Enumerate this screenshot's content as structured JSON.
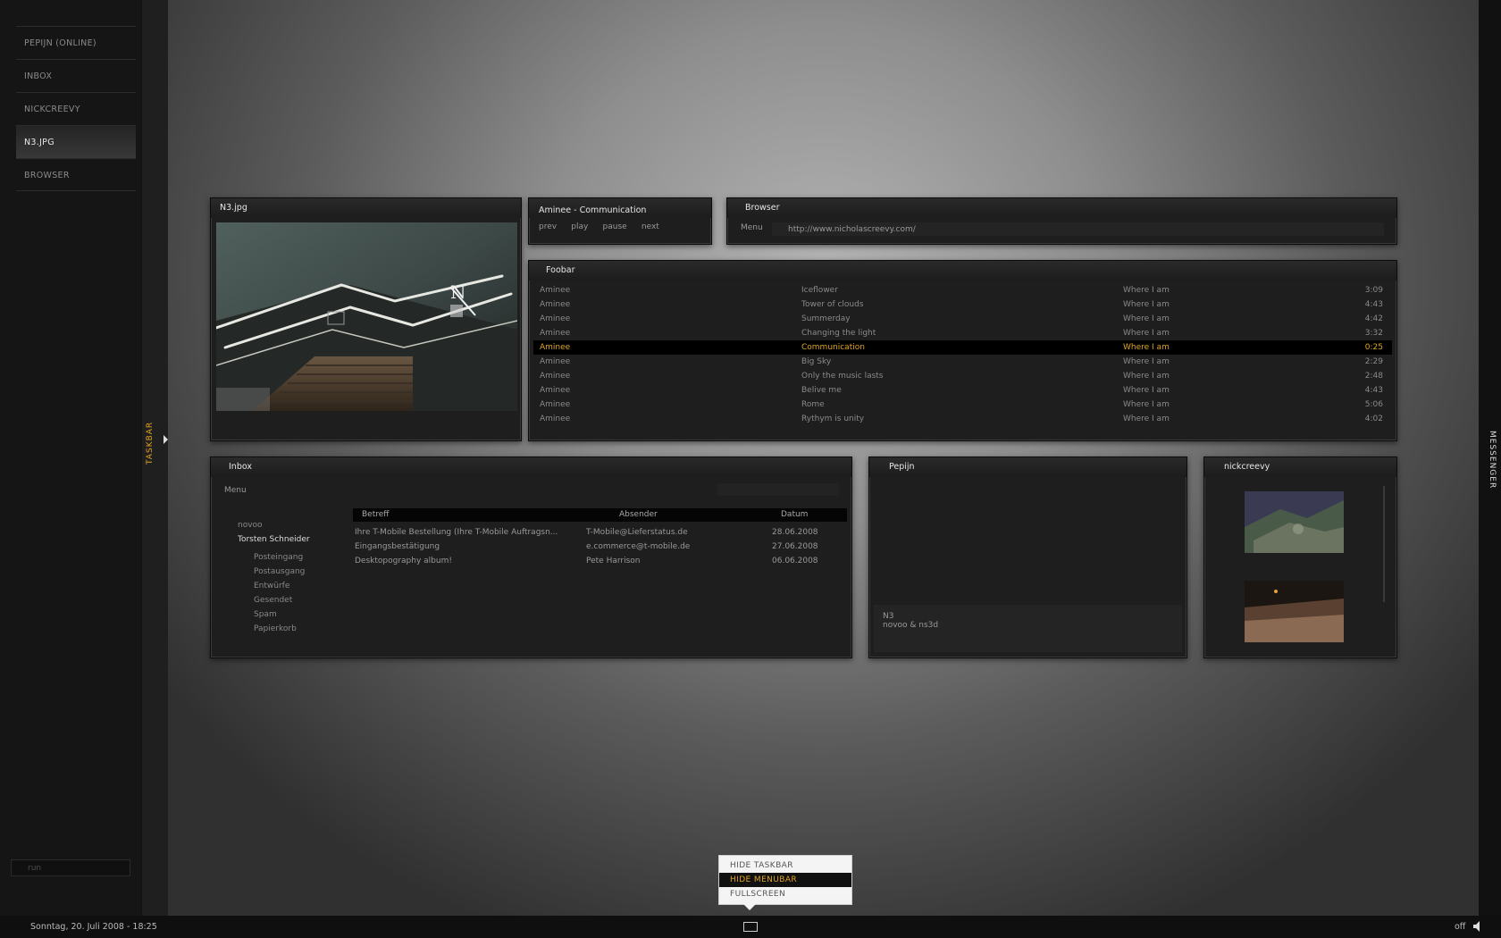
{
  "sidebar": {
    "items": [
      {
        "label": "PEPIJN (ONLINE)",
        "active": false
      },
      {
        "label": "INBOX",
        "active": false
      },
      {
        "label": "NICKCREEVY",
        "active": false
      },
      {
        "label": "N3.JPG",
        "active": true
      },
      {
        "label": "BROWSER",
        "active": false
      }
    ],
    "run_placeholder": "run"
  },
  "taskbar_label": "TASKBAR",
  "messenger_label": "MESSENGER",
  "bottombar": {
    "clock": "Sonntag, 20. Juli 2008 - 18:25",
    "sound": "off"
  },
  "popup": {
    "items": [
      "HIDE TASKBAR",
      "HIDE MENUBAR",
      "FULLSCREEN"
    ],
    "highlighted_index": 1
  },
  "image_window": {
    "title": "N3.jpg"
  },
  "player": {
    "title": "Aminee - Communication",
    "controls": [
      "prev",
      "play",
      "pause",
      "next"
    ]
  },
  "browser": {
    "title": "Browser",
    "menu": "Menu",
    "url": "http://www.nicholascreevy.com/"
  },
  "foobar": {
    "title": "Foobar",
    "playing_index": 4,
    "tracks": [
      {
        "artist": "Aminee",
        "title": "Iceflower",
        "album": "Where I am",
        "length": "3:09"
      },
      {
        "artist": "Aminee",
        "title": "Tower of clouds",
        "album": "Where I am",
        "length": "4:43"
      },
      {
        "artist": "Aminee",
        "title": "Summerday",
        "album": "Where I am",
        "length": "4:42"
      },
      {
        "artist": "Aminee",
        "title": "Changing the light",
        "album": "Where I am",
        "length": "3:32"
      },
      {
        "artist": "Aminee",
        "title": "Communication",
        "album": "Where I am",
        "length": "0:25"
      },
      {
        "artist": "Aminee",
        "title": "Big Sky",
        "album": "Where I am",
        "length": "2:29"
      },
      {
        "artist": "Aminee",
        "title": "Only the music lasts",
        "album": "Where I am",
        "length": "2:48"
      },
      {
        "artist": "Aminee",
        "title": "Belive me",
        "album": "Where I am",
        "length": "4:43"
      },
      {
        "artist": "Aminee",
        "title": "Rome",
        "album": "Where I am",
        "length": "5:06"
      },
      {
        "artist": "Aminee",
        "title": "Rythym is unity",
        "album": "Where I am",
        "length": "4:02"
      }
    ]
  },
  "inbox": {
    "title": "Inbox",
    "menu": "Menu",
    "account": "novoo",
    "user": "Torsten Schneider",
    "folders": [
      "Posteingang",
      "Postausgang",
      "Entwürfe",
      "Gesendet",
      "Spam",
      "Papierkorb"
    ],
    "columns": {
      "subject": "Betreff",
      "sender": "Absender",
      "date": "Datum"
    },
    "messages": [
      {
        "subject": "Ihre T-Mobile Bestellung (Ihre T-Mobile Auftragsn...",
        "sender": "T-Mobile@Lieferstatus.de",
        "date": "28.06.2008"
      },
      {
        "subject": "Eingangsbestätigung",
        "sender": "e.commerce@t-mobile.de",
        "date": "27.06.2008"
      },
      {
        "subject": "Desktopography album!",
        "sender": "Pete Harrison",
        "date": "06.06.2008"
      }
    ]
  },
  "chat": {
    "title": "Pepijn",
    "line1": "N3",
    "line2": "novoo & ns3d"
  },
  "gallery": {
    "title": "nickcreevy"
  }
}
